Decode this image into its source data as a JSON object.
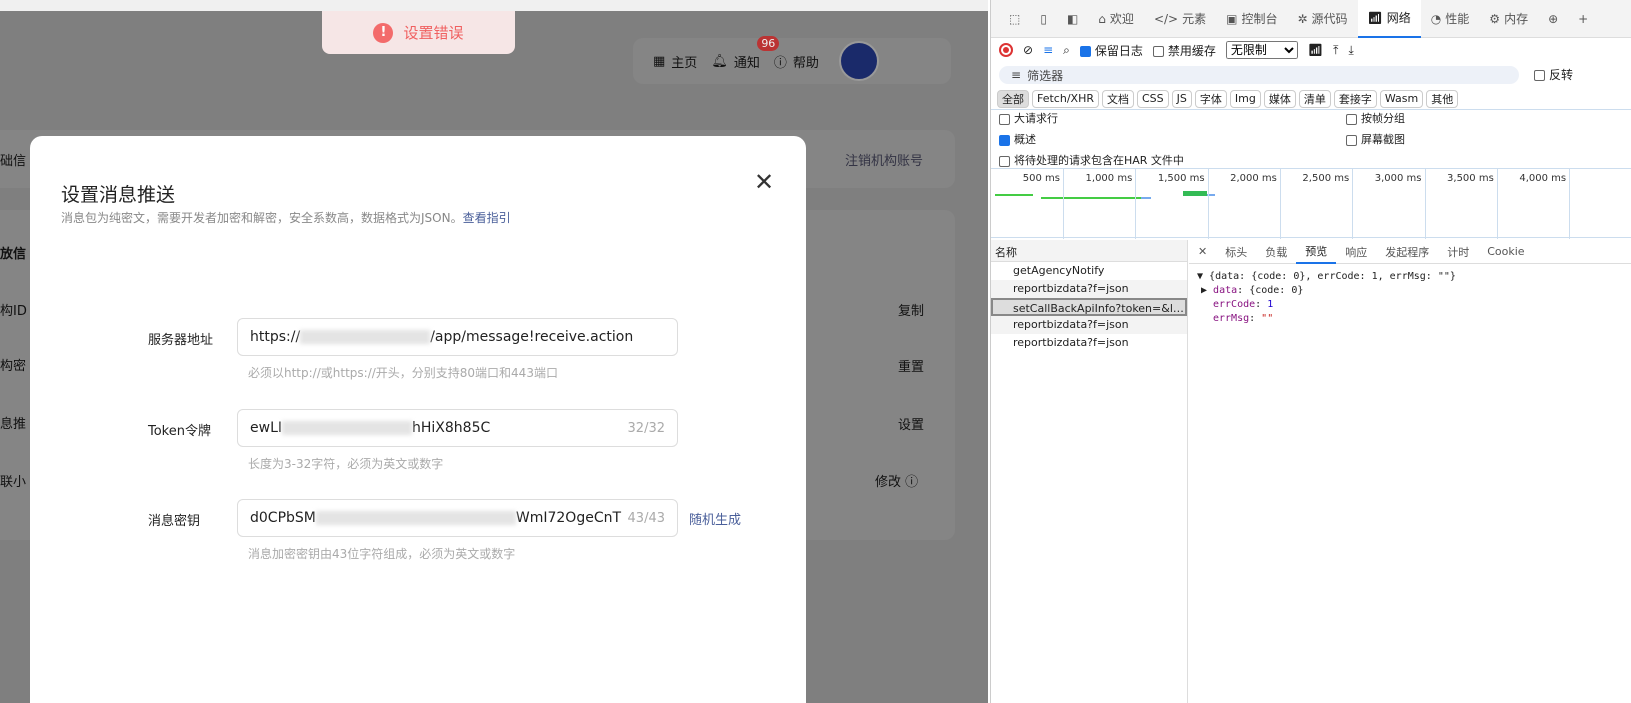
{
  "toast": {
    "message": "设置错误",
    "icon": "error-icon"
  },
  "nav": {
    "home": "主页",
    "notify": "通知",
    "notify_count": "96",
    "help": "帮助"
  },
  "background": {
    "section1": "础信",
    "deregister": "注销机构账号",
    "section2": "放信",
    "row1": "构ID",
    "row2": "构密",
    "row3": "息推",
    "row4": "联小",
    "copy": "复制",
    "reset": "重置",
    "set": "设置",
    "modify": "修改"
  },
  "modal": {
    "title": "设置消息推送",
    "subtitle": "消息包为纯密文，需要开发者加密和解密，安全系数高，数据格式为JSON。",
    "guide_link": "查看指引",
    "fields": [
      {
        "label": "服务器地址",
        "value_start": "https://",
        "value_end": "/app/message!receive.action",
        "count": "",
        "hint": "必须以http://或https://开头，分别支持80端口和443端口"
      },
      {
        "label": "Token令牌",
        "value_start": "ewLI",
        "value_end": "hHiX8h85C",
        "count": "32/32",
        "hint": "长度为3-32字符，必须为英文或数字"
      },
      {
        "label": "消息密钥",
        "value_start": "d0CPbSM",
        "value_end": "WmI72OgeCnT",
        "count": "43/43",
        "hint": "消息加密密钥由43位字符组成，必须为英文或数字"
      }
    ],
    "random_generate": "随机生成"
  },
  "devtools": {
    "tabs": [
      "欢迎",
      "元素",
      "控制台",
      "源代码",
      "网络",
      "性能",
      "内存"
    ],
    "active_tab": "网络",
    "preserve_log": "保留日志",
    "disable_cache": "禁用缓存",
    "throttle": "无限制",
    "filter_placeholder": "筛选器",
    "invert": "反转",
    "types": [
      "全部",
      "Fetch/XHR",
      "文档",
      "CSS",
      "JS",
      "字体",
      "Img",
      "媒体",
      "清单",
      "套接字",
      "Wasm",
      "其他"
    ],
    "options": {
      "big_rows": "大请求行",
      "group_frame": "按帧分组",
      "overview": "概述",
      "screenshots": "屏幕截图",
      "har": "将待处理的请求包含在HAR 文件中"
    },
    "timeline_ticks": [
      "500 ms",
      "1,000 ms",
      "1,500 ms",
      "2,000 ms",
      "2,500 ms",
      "3,000 ms",
      "3,500 ms",
      "4,000 ms"
    ],
    "name_header": "名称",
    "requests": [
      "getAgencyNotify",
      "reportbizdata?f=json",
      "setCallBackApiInfo?token=&lang...",
      "reportbizdata?f=json",
      "reportbizdata?f=json"
    ],
    "detail_tabs": [
      "标头",
      "负载",
      "预览",
      "响应",
      "发起程序",
      "计时",
      "Cookie"
    ],
    "active_detail_tab": "预览",
    "preview": {
      "summary": "{data: {code: 0}, errCode: 1, errMsg: \"\"}",
      "data_key": "data",
      "data_val": "{code: 0}",
      "errcode_key": "errCode",
      "errcode_val": "1",
      "errmsg_key": "errMsg",
      "errmsg_val": "\"\""
    }
  }
}
